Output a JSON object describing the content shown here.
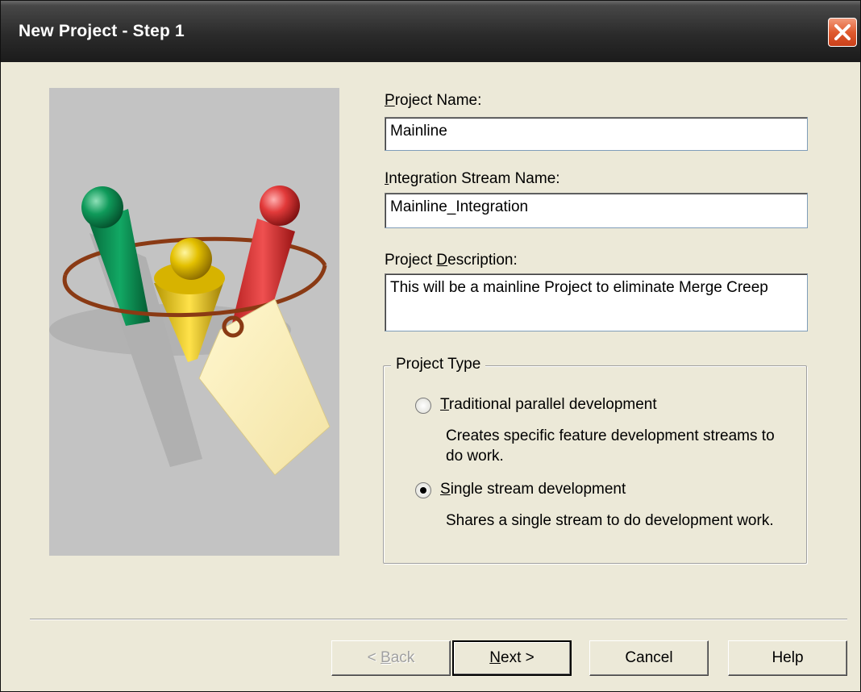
{
  "window": {
    "title": "New Project - Step 1"
  },
  "form": {
    "project_name": {
      "label_prefix": "P",
      "label_rest": "roject Name:",
      "value": "Mainline"
    },
    "stream_name": {
      "label_prefix": "I",
      "label_rest": "ntegration Stream Name:",
      "value": "Mainline_Integration"
    },
    "description": {
      "label_start": "Project ",
      "label_accel": "D",
      "label_rest": "escription:",
      "value": "This will be a mainline Project to eliminate Merge Creep"
    }
  },
  "project_type": {
    "legend": "Project Type",
    "options": [
      {
        "accel": "T",
        "label_rest": "raditional parallel development",
        "description": "Creates specific feature development streams to do work.",
        "selected": false
      },
      {
        "accel": "S",
        "label_rest": "ingle stream development",
        "description": "Shares a single stream to do development work.",
        "selected": true
      }
    ]
  },
  "buttons": {
    "back": {
      "prefix": "< ",
      "accel": "B",
      "rest": "ack"
    },
    "next": {
      "accel": "N",
      "rest": "ext >"
    },
    "cancel": "Cancel",
    "help": "Help"
  },
  "icons": {
    "close": "close-icon",
    "illustration": "project-illustration"
  },
  "colors": {
    "titlebar": "#2b2b2b",
    "close_button": "#e05b2f",
    "dialog_face": "#ece9d8",
    "illustration_bg": "#c3c3c3"
  }
}
